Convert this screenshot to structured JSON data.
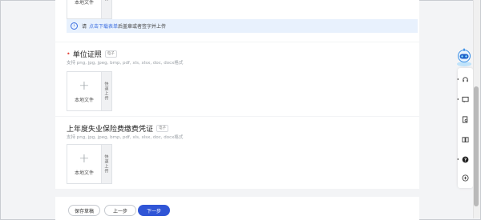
{
  "upload_common": {
    "local_label": "本地文件",
    "quick_label": "快速上传",
    "quick_label_partial": "传"
  },
  "notice": {
    "prefix": "请",
    "link": "点击下载表单",
    "suffix": "后盖章或者签字并上传"
  },
  "sections": [
    {
      "title": "单位证照",
      "required": true,
      "tag": "电子",
      "support": "支持 png, jpg, jpeg, bmp, pdf, xls, xlsx, doc, docx格式"
    },
    {
      "title": "上年度失业保险费缴费凭证",
      "required": false,
      "tag": "电子",
      "support": "支持 png, jpg, jpeg, bmp, pdf, xls, xlsx, doc, docx格式"
    }
  ],
  "actions": {
    "save": "保存草稿",
    "prev": "上一步",
    "next": "下一步"
  },
  "colors": {
    "primary": "#3055d6",
    "link": "#3d6fe0",
    "notice_bg": "#e8f1fd",
    "required": "#e4453a"
  },
  "side_tools": [
    "robot-assistant-icon",
    "headset-icon",
    "message-icon",
    "document-search-icon",
    "book-icon",
    "help-icon",
    "plus-icon"
  ]
}
